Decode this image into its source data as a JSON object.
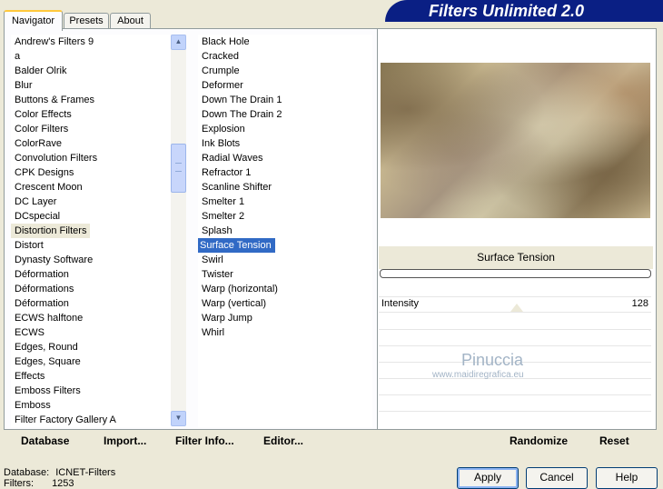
{
  "app_title": "Filters Unlimited 2.0",
  "tabs": [
    {
      "label": "Navigator"
    },
    {
      "label": "Presets"
    },
    {
      "label": "About"
    }
  ],
  "categories": [
    "Andrew's Filters 9",
    "a",
    "Balder Olrik",
    "Blur",
    "Buttons & Frames",
    "Color Effects",
    "Color Filters",
    "ColorRave",
    "Convolution Filters",
    "CPK Designs",
    "Crescent Moon",
    "DC Layer",
    "DCspecial",
    "Distortion Filters",
    "Distort",
    "Dynasty Software",
    "Déformation",
    "Déformations",
    "Déformation",
    "ECWS halftone",
    "ECWS",
    "Edges, Round",
    "Edges, Square",
    "Effects",
    "Emboss Filters",
    "Emboss",
    "Filter Factory Gallery A"
  ],
  "selected_category": "Distortion Filters",
  "filters": [
    "Black Hole",
    "Cracked",
    "Crumple",
    "Deformer",
    "Down The Drain 1",
    "Down The Drain 2",
    "Explosion",
    "Ink Blots",
    "Radial Waves",
    "Refractor 1",
    "Scanline Shifter",
    "Smelter 1",
    "Smelter 2",
    "Splash",
    "Surface Tension",
    "Swirl",
    "Twister",
    "Warp (horizontal)",
    "Warp (vertical)",
    "Warp Jump",
    "Whirl"
  ],
  "selected_filter": "Surface Tension",
  "preview_filter_name": "Surface Tension",
  "parameter": {
    "label": "Intensity",
    "value": "128"
  },
  "watermark": {
    "line1": "Pinuccia",
    "line2": "www.maidiregrafica.eu"
  },
  "link_buttons": {
    "database": "Database",
    "import": "Import...",
    "filter_info": "Filter Info...",
    "editor": "Editor...",
    "randomize": "Randomize",
    "reset": "Reset"
  },
  "buttons": {
    "apply": "Apply",
    "cancel": "Cancel",
    "help": "Help"
  },
  "status": {
    "database_label": "Database:",
    "database_value": "ICNET-Filters",
    "filters_label": "Filters:",
    "filters_value": "1253"
  },
  "colors": {
    "banner": "#0a1f84",
    "selection": "#316ac5",
    "tab_highlight": "#ffc83c"
  },
  "icons": [
    "scroll-up-icon",
    "scroll-down-icon",
    "scroll-grip-icon"
  ]
}
